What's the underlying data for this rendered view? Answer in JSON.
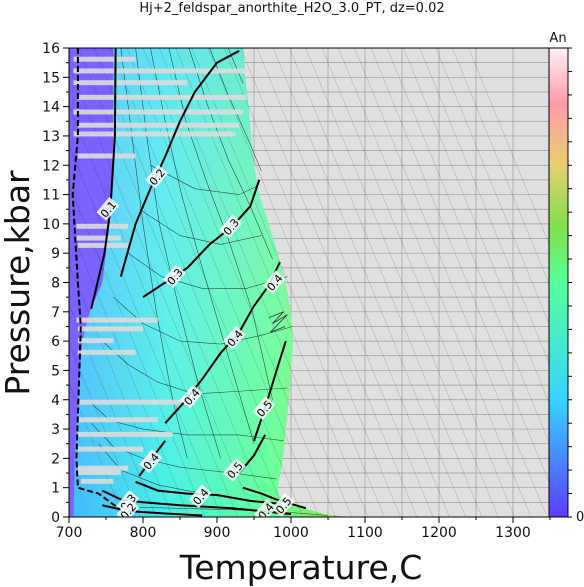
{
  "chart_data": {
    "type": "heatmap",
    "title": "Hj+2_feldspar_anorthite_H2O_3.0_PT, dz=0.02",
    "xlabel": "Temperature,C",
    "ylabel": "Pressure,kbar",
    "xlim": [
      700,
      1350
    ],
    "ylim": [
      0,
      16
    ],
    "xticks": [
      700,
      800,
      900,
      1000,
      1100,
      1200,
      1300
    ],
    "yticks": [
      0,
      1,
      2,
      3,
      4,
      5,
      6,
      7,
      8,
      9,
      10,
      11,
      12,
      13,
      14,
      15,
      16
    ],
    "grid": true,
    "colorbar": {
      "label": "An",
      "min_label": "0",
      "colors_bottom_to_top": [
        "#5a3cff",
        "#36d4ff",
        "#56ff9a",
        "#7fe04a",
        "#e8d070",
        "#ff9aa8",
        "#fff0f8"
      ]
    },
    "contour_levels": [
      0.1,
      0.2,
      0.3,
      0.4,
      0.5
    ],
    "contour_labels": [
      {
        "text": "0.1",
        "x": 753,
        "y": 10.5
      },
      {
        "text": "0.2",
        "x": 819,
        "y": 11.6
      },
      {
        "text": "0.3",
        "x": 919,
        "y": 9.9
      },
      {
        "text": "0.3",
        "x": 843,
        "y": 8.2
      },
      {
        "text": "0.4",
        "x": 978,
        "y": 8.0
      },
      {
        "text": "0.4",
        "x": 924,
        "y": 6.1
      },
      {
        "text": "0.4",
        "x": 866,
        "y": 4.1
      },
      {
        "text": "0.5",
        "x": 964,
        "y": 3.7
      },
      {
        "text": "0.4",
        "x": 811,
        "y": 1.9
      },
      {
        "text": "0.5",
        "x": 924,
        "y": 1.6
      },
      {
        "text": "0.4",
        "x": 878,
        "y": 0.7
      },
      {
        "text": "0.3",
        "x": 780,
        "y": 0.5
      },
      {
        "text": "0.2",
        "x": 780,
        "y": 0.2
      },
      {
        "text": "0.5",
        "x": 990,
        "y": 0.4
      },
      {
        "text": "0.4",
        "x": 966,
        "y": 0.2
      }
    ]
  }
}
